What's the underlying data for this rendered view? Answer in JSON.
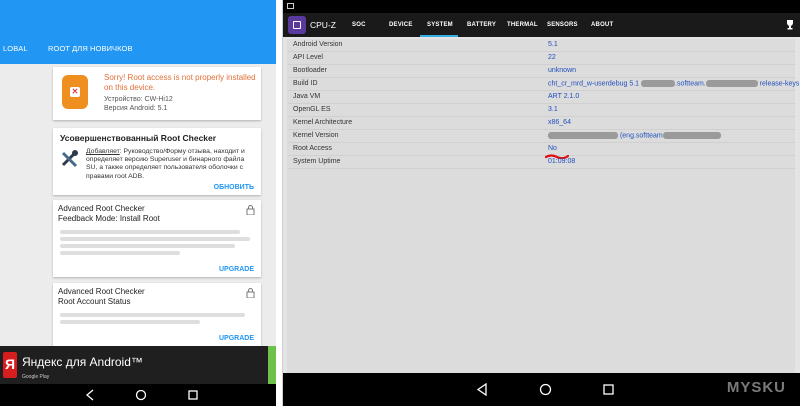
{
  "left": {
    "tabs": [
      "LOBAL",
      "ROOT ДЛЯ НОВИЧКОВ"
    ],
    "card1": {
      "title": "Sorry! Root access is not properly installed on this device.",
      "device": "Устройство: CW-Hi12",
      "version": "Версия Android: 5.1"
    },
    "card2": {
      "title": "Усовершенствованный Root Checker",
      "desc_prefix": "Добавляет",
      "desc": ": Руководство/Форму отзыва, находит и определяет версию Superuser и бинарного файла SU, а также определяет пользователя оболочки с правами root ADB.",
      "action": "ОБНОВИТЬ"
    },
    "card3": {
      "title_1": "Advanced Root Checker",
      "title_2": "Feedback Mode: Install Root",
      "action": "UPGRADE"
    },
    "card4": {
      "title_1": "Advanced Root Checker",
      "title_2": "Root Account Status",
      "action": "UPGRADE"
    },
    "ad": {
      "text": "Яндекс для Android™",
      "sub": "Google Play"
    },
    "colors": {
      "appbar": "#2196f3",
      "warning": "#e0703a",
      "action": "#2196f3"
    }
  },
  "right": {
    "app_title": "CPU-Z",
    "tabs": [
      "SOC",
      "DEVICE",
      "SYSTEM",
      "BATTERY",
      "THERMAL",
      "SENSORS",
      "ABOUT"
    ],
    "active_tab": "SYSTEM",
    "rows": [
      {
        "key": "Android Version",
        "value": "5.1"
      },
      {
        "key": "API Level",
        "value": "22"
      },
      {
        "key": "Bootloader",
        "value": "unknown"
      },
      {
        "key": "Build ID",
        "value_a": "cht_cr_mrd_w-userdebug 5.1",
        "value_b": ".softteam.",
        "value_c": "release-keys"
      },
      {
        "key": "Java VM",
        "value": "ART 2.1.0"
      },
      {
        "key": "OpenGL ES",
        "value": "3.1"
      },
      {
        "key": "Kernel Architecture",
        "value": "x86_64"
      },
      {
        "key": "Kernel Version",
        "value_b": "(eng.softteam"
      },
      {
        "key": "Root Access",
        "value": "No"
      },
      {
        "key": "System Uptime",
        "value": "01:09:08"
      }
    ],
    "watermark": "MYSKU",
    "colors": {
      "value_text": "#1f4fbd",
      "tab_underline": "#34aee0",
      "app_icon": "#5b3aa0"
    }
  }
}
